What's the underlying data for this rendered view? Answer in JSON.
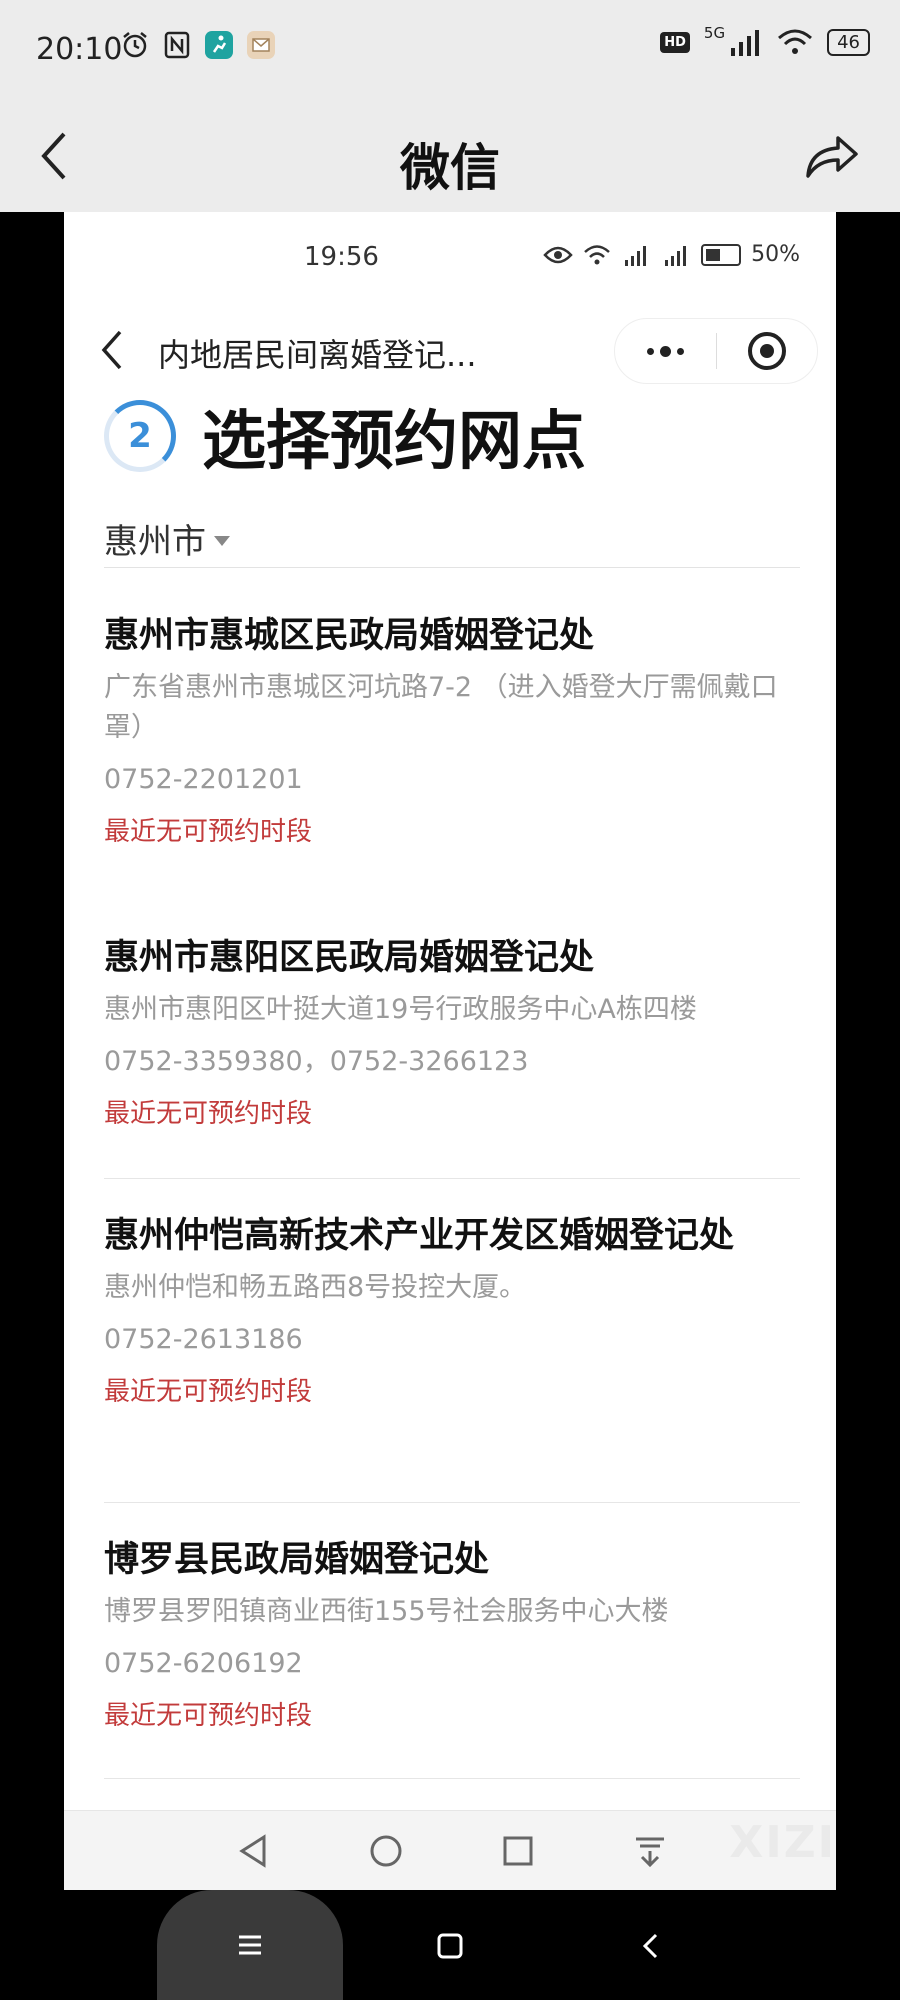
{
  "outer_status": {
    "time": "20:10",
    "network": "5G",
    "battery": "46"
  },
  "outer_title": {
    "title": "微信"
  },
  "inner_status": {
    "time": "19:56",
    "battery": "50%"
  },
  "inner_nav": {
    "title": "内地居民间离婚登记..."
  },
  "step": {
    "number": "2",
    "title": "选择预约网点"
  },
  "city": {
    "label": "惠州市"
  },
  "offices": [
    {
      "name": "惠州市惠城区民政局婚姻登记处",
      "address": "广东省惠州市惠城区河坑路7-2 （进入婚登大厅需佩戴口罩）",
      "phone": "0752-2201201",
      "status": "最近无可预约时段"
    },
    {
      "name": "惠州市惠阳区民政局婚姻登记处",
      "address": "惠州市惠阳区叶挺大道19号行政服务中心A栋四楼",
      "phone": "0752-3359380，0752-3266123",
      "status": "最近无可预约时段"
    },
    {
      "name": "惠州仲恺高新技术产业开发区婚姻登记处",
      "address": "惠州仲恺和畅五路西8号投控大厦。",
      "phone": "0752-2613186",
      "status": "最近无可预约时段"
    },
    {
      "name": "博罗县民政局婚姻登记处",
      "address": "博罗县罗阳镇商业西街155号社会服务中心大楼",
      "phone": "0752-6206192",
      "status": "最近无可预约时段"
    }
  ],
  "watermark": "XIZI",
  "colors": {
    "accent_blue": "#3b8fd9",
    "status_red": "#c23b3b",
    "muted": "#9a9a9a"
  }
}
